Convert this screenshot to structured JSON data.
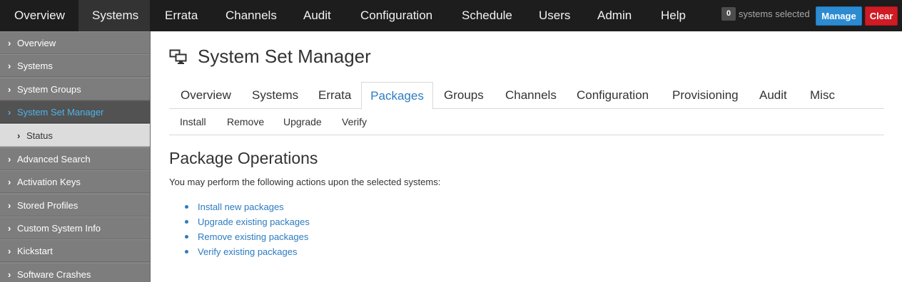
{
  "topnav": {
    "items": [
      "Overview",
      "Systems",
      "Errata",
      "Channels",
      "Audit",
      "Configuration",
      "Schedule",
      "Users",
      "Admin",
      "Help"
    ],
    "active": "Systems",
    "selected_count": "0",
    "selected_text": "systems selected",
    "manage_label": "Manage",
    "clear_label": "Clear"
  },
  "sidebar": {
    "items": [
      {
        "label": "Overview"
      },
      {
        "label": "Systems"
      },
      {
        "label": "System Groups"
      },
      {
        "label": "System Set Manager"
      },
      {
        "label": "Status"
      },
      {
        "label": "Advanced Search"
      },
      {
        "label": "Activation Keys"
      },
      {
        "label": "Stored Profiles"
      },
      {
        "label": "Custom System Info"
      },
      {
        "label": "Kickstart"
      },
      {
        "label": "Software Crashes"
      }
    ],
    "chevron": "›"
  },
  "page": {
    "title": "System Set Manager",
    "icon": "system-set-icon"
  },
  "tabs": [
    "Overview",
    "Systems",
    "Errata",
    "Packages",
    "Groups",
    "Channels",
    "Configuration",
    "Provisioning",
    "Audit",
    "Misc"
  ],
  "active_tab": "Packages",
  "subtabs": [
    "Install",
    "Remove",
    "Upgrade",
    "Verify"
  ],
  "content": {
    "heading": "Package Operations",
    "description": "You may perform the following actions upon the selected systems:",
    "actions": [
      "Install new packages",
      "Upgrade existing packages",
      "Remove existing packages",
      "Verify existing packages"
    ]
  },
  "colors": {
    "nav_bg": "#1d1d1d",
    "link": "#2c7bc1",
    "manage": "#2c8bd1",
    "clear": "#cf1b24",
    "sidebar_active_text": "#4fb3e8"
  }
}
